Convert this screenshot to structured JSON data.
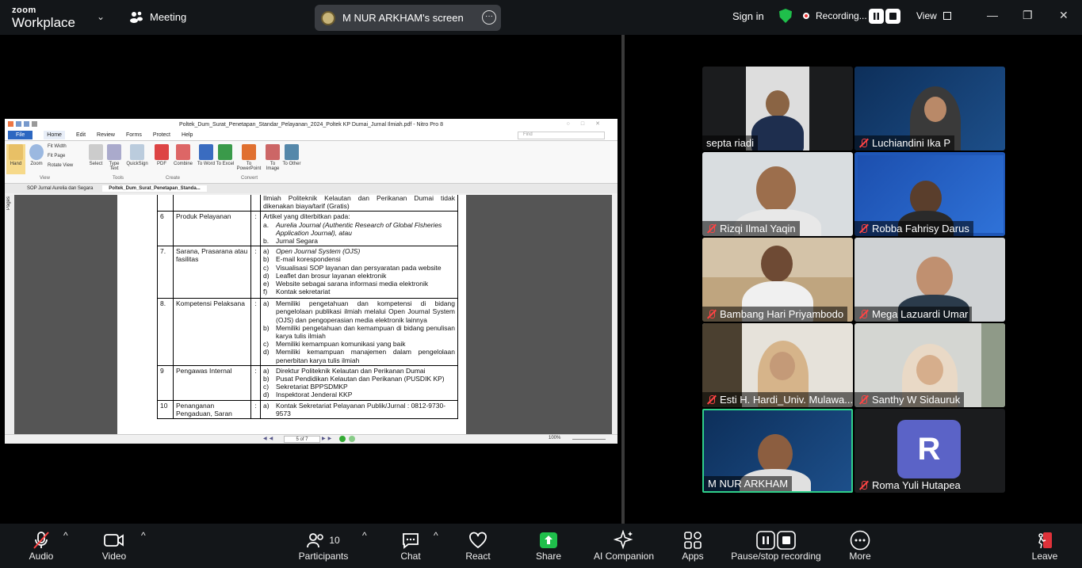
{
  "topbar": {
    "logo_line1": "zoom",
    "logo_line2": "Workplace",
    "meeting_label": "Meeting",
    "screen_share_label": "M NUR ARKHAM's screen",
    "sign_in": "Sign in",
    "recording_label": "Recording...",
    "view_label": "View"
  },
  "nitro": {
    "window_title": "Poltek_Dum_Surat_Penetapan_Standar_Pelayanan_2024_Poltek KP Dumai_Jurnal Ilmiah.pdf - Nitro Pro 8",
    "menu_tabs": [
      "File",
      "Home",
      "Edit",
      "Review",
      "Forms",
      "Protect",
      "Help"
    ],
    "find_placeholder": "Find",
    "ribbon": {
      "hand": "Hand",
      "zoom": "Zoom",
      "fit_width": "Fit Width",
      "fit_page": "Fit Page",
      "rotate_view": "Rotate View",
      "select": "Select",
      "type_text": "Type Text",
      "quicksign": "QuickSign",
      "pdf": "PDF",
      "combine": "Combine",
      "to_word": "To Word",
      "to_excel": "To Excel",
      "to_powerpoint": "To PowerPoint",
      "to_image": "To Image",
      "to_other": "To Other",
      "group_view": "View",
      "group_tools": "Tools",
      "group_create": "Create",
      "group_convert": "Convert"
    },
    "doc_tabs": [
      "SOP Jurnal Aurelia dan Segara",
      "Poltek_Dum_Surat_Penetapan_Standa..."
    ],
    "pages_label": "Pages",
    "page_indicator": "5 of 7",
    "zoom_level": "100%",
    "table": {
      "top_text": [
        "Ilmiah Politeknik Kelautan dan Perikanan Dumai tidak",
        "dikenakan biaya/tarif (Gratis)"
      ],
      "rows": [
        {
          "no": "6",
          "label": "Produk Pelayanan",
          "colon": ":",
          "intro": "Artikel yang diterbitkan pada:",
          "items": [
            {
              "k": "a.",
              "t": "Aurelia Journal (Authentic Research of Global Fisheries Application Journal), atau"
            },
            {
              "k": "b.",
              "t": "Jurnal Segara"
            }
          ]
        },
        {
          "no": "7.",
          "label": "Sarana, Prasarana atau fasilitas",
          "colon": ":",
          "intro": "",
          "items": [
            {
              "k": "a)",
              "t": "Open Journal System (OJS)"
            },
            {
              "k": "b)",
              "t": "E-mail korespondensi"
            },
            {
              "k": "c)",
              "t": "Visualisasi SOP layanan dan persyaratan pada website"
            },
            {
              "k": "d)",
              "t": "Leaflet dan brosur layanan elektronik"
            },
            {
              "k": "e)",
              "t": "Website sebagai sarana informasi media elektronik"
            },
            {
              "k": "f)",
              "t": "Kontak sekretariat"
            }
          ]
        },
        {
          "no": "8.",
          "label": "Kompetensi Pelaksana",
          "colon": ":",
          "intro": "",
          "items": [
            {
              "k": "a)",
              "t": "Memiliki pengetahuan dan kompetensi di bidang pengelolaan publikasi ilmiah melalui Open Journal System (OJS) dan pengoperasian media elektronik lainnya"
            },
            {
              "k": "b)",
              "t": "Memiliki pengetahuan dan kemampuan di bidang penulisan karya tulis ilmiah"
            },
            {
              "k": "c)",
              "t": "Memiliki kemampuan komunikasi yang baik"
            },
            {
              "k": "d)",
              "t": "Memiliki kemampuan manajemen dalam pengelolaan penerbitan karya tulis ilmiah"
            }
          ]
        },
        {
          "no": "9",
          "label": "Pengawas Internal",
          "colon": ":",
          "intro": "",
          "items": [
            {
              "k": "a)",
              "t": "Direktur Politeknik Kelautan dan Perikanan Dumai"
            },
            {
              "k": "b)",
              "t": "Pusat Pendidikan Kelautan dan Perikanan (PUSDIK KP)"
            },
            {
              "k": "c)",
              "t": "Sekretariat BPPSDMKP"
            },
            {
              "k": "d)",
              "t": "Inspektorat Jenderal KKP"
            }
          ]
        },
        {
          "no": "10",
          "label": "Penanganan Pengaduan, Saran",
          "colon": ":",
          "intro": "",
          "items": [
            {
              "k": "a)",
              "t": "Kontak Sekretariat Pelayanan Publik/Jurnal : 0812-9730-9573"
            }
          ]
        }
      ]
    }
  },
  "participants": [
    {
      "name": "septa riadi",
      "muted": false
    },
    {
      "name": "Luchiandini Ika P",
      "muted": true
    },
    {
      "name": "Rizqi Ilmal Yaqin",
      "muted": true
    },
    {
      "name": "Robba Fahrisy Darus",
      "muted": true
    },
    {
      "name": "Bambang Hari Priyambodo",
      "muted": true
    },
    {
      "name": "Mega Lazuardi Umar",
      "muted": true
    },
    {
      "name": "Esti H. Hardi_Univ. Mulawa...",
      "muted": true
    },
    {
      "name": "Santhy W Sidauruk",
      "muted": true
    },
    {
      "name": "M NUR ARKHAM",
      "muted": false
    },
    {
      "name": "Roma Yuli Hutapea",
      "muted": true
    }
  ],
  "avatar_letter": "R",
  "toolbar": {
    "audio": "Audio",
    "video": "Video",
    "participants": "Participants",
    "participants_count": "10",
    "chat": "Chat",
    "react": "React",
    "share": "Share",
    "ai_companion": "AI Companion",
    "apps": "Apps",
    "pause_stop": "Pause/stop recording",
    "more": "More",
    "leave": "Leave"
  },
  "colors": {
    "share_green": "#1fbf4b",
    "leave_red": "#e0323a",
    "active_speaker_border": "#2fd08a",
    "avatar_purple": "#5b63c7"
  }
}
